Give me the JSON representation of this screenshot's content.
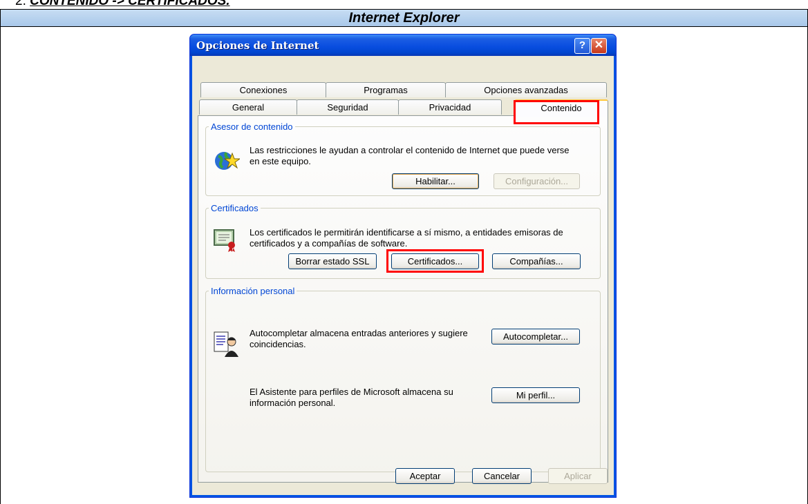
{
  "doc": {
    "step_number": "2.",
    "step_path": "CONTENIDO -> CERTIFICADOS.",
    "table_header": "Internet Explorer"
  },
  "dialog": {
    "title": "Opciones de Internet",
    "help_glyph": "?",
    "close_glyph": "✕",
    "tabs_row1": [
      "Conexiones",
      "Programas",
      "Opciones avanzadas"
    ],
    "tabs_row2": [
      "General",
      "Seguridad",
      "Privacidad",
      "Contenido"
    ],
    "active_tab": "Contenido",
    "content_advisor": {
      "legend": "Asesor de contenido",
      "text": "Las restricciones le ayudan a controlar el contenido de Internet que puede verse en este equipo.",
      "enable_button": "Habilitar...",
      "settings_button": "Configuración..."
    },
    "certificates": {
      "legend": "Certificados",
      "text": "Los certificados le permitirán identificarse a sí mismo, a entidades emisoras de certificados y a compañías de software.",
      "clear_ssl_button": "Borrar estado SSL",
      "certificates_button": "Certificados...",
      "publishers_button": "Compañías..."
    },
    "personal_info": {
      "legend": "Información personal",
      "autocomplete_text": "Autocompletar almacena entradas anteriores y sugiere coincidencias.",
      "autocomplete_button": "Autocompletar...",
      "profile_text": "El Asistente para perfiles de Microsoft almacena su información personal.",
      "profile_button": "Mi perfil..."
    },
    "footer": {
      "ok_button": "Aceptar",
      "cancel_button": "Cancelar",
      "apply_button": "Aplicar"
    }
  },
  "icons": {
    "advisor": "globe-star-icon",
    "certificate": "certificate-icon",
    "profile": "person-document-icon",
    "help": "help-icon",
    "close": "close-icon"
  },
  "colors": {
    "highlight": "#ff0000",
    "titlebar": "#0a4ee0",
    "dialog_bg": "#ece9d8",
    "legend": "#0046d5",
    "active_tab_accent": "#ffc83c"
  }
}
